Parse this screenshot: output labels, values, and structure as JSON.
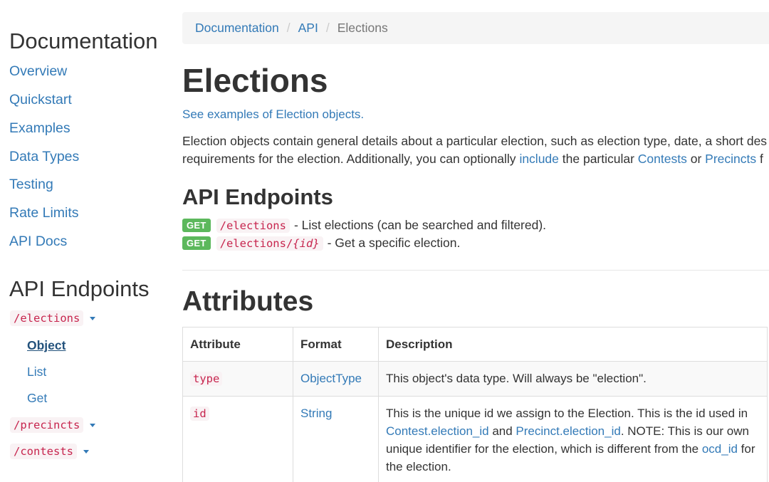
{
  "sidebar": {
    "doc_heading": "Documentation",
    "links": [
      "Overview",
      "Quickstart",
      "Examples",
      "Data Types",
      "Testing",
      "Rate Limits",
      "API Docs"
    ],
    "endpoints_heading": "API Endpoints",
    "endpoints": [
      {
        "path": "/elections",
        "sub": [
          "Object",
          "List",
          "Get"
        ],
        "active_sub": "Object"
      },
      {
        "path": "/precincts"
      },
      {
        "path": "/contests"
      }
    ]
  },
  "breadcrumb": [
    "Documentation",
    "API",
    "Elections"
  ],
  "page": {
    "title": "Elections",
    "examples_link": "See examples of Election objects.",
    "desc_line1": "Election objects contain general details about a particular election, such as election type, date, a short des",
    "desc_line2_a": "requirements for the election. Additionally, you can optionally ",
    "desc_link_include": "include",
    "desc_line2_b": " the particular ",
    "desc_link_contests": "Contests",
    "desc_line2_c": " or ",
    "desc_link_precincts": "Precincts",
    "desc_line2_d": " f"
  },
  "endpoints_section": {
    "heading": "API Endpoints",
    "items": [
      {
        "method": "GET",
        "path": "/elections",
        "param": "",
        "desc": " - List elections (can be searched and filtered)."
      },
      {
        "method": "GET",
        "path": "/elections/",
        "param": "{id}",
        "desc": " - Get a specific election."
      }
    ]
  },
  "attributes": {
    "heading": "Attributes",
    "columns": [
      "Attribute",
      "Format",
      "Description"
    ],
    "rows": [
      {
        "attr": "type",
        "format": "ObjectType",
        "desc": "This object's data type. Will always be \"election\"."
      },
      {
        "attr": "id",
        "format": "String",
        "desc_a": "This is the unique id we assign to the Election. This is the id used in ",
        "link1": "Contest.election_id",
        "desc_b": " and ",
        "link2": "Precinct.election_id",
        "desc_c": ". NOTE: This is our own unique identifier for the election, which is different from the ",
        "link3": "ocd_id",
        "desc_d": " for the election."
      }
    ]
  },
  "colors": {
    "link": "#337ab7",
    "code_text": "#c7254e",
    "code_bg": "#f9f2f4",
    "get_badge": "#5cb85c"
  }
}
